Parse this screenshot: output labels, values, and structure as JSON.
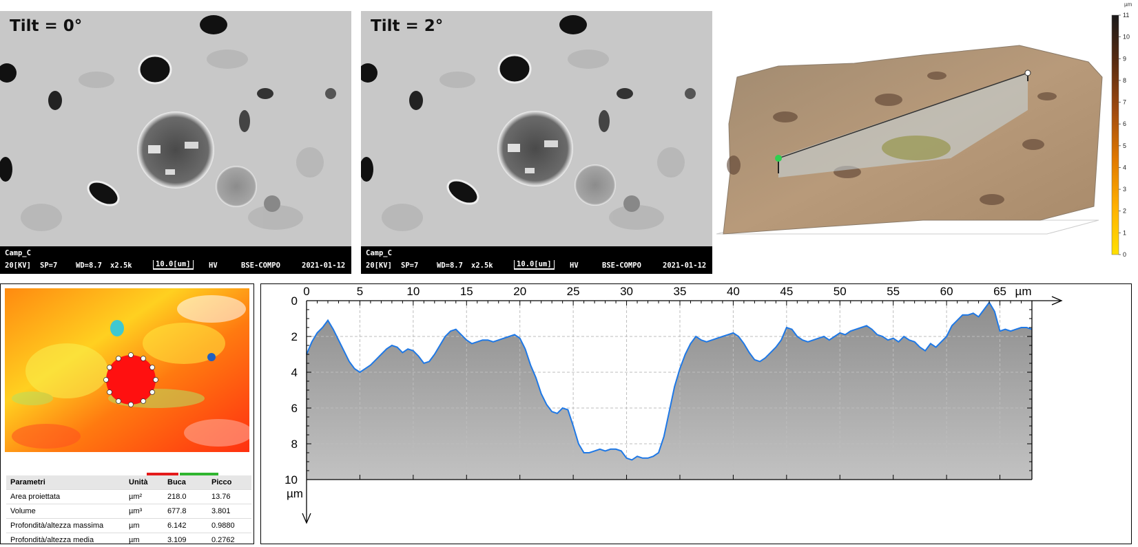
{
  "sem_panels": [
    {
      "tilt": "Tilt = 0°",
      "sample": "Camp_C",
      "kv": "20[KV]",
      "sp": "SP=7",
      "wd": "WD=8.7",
      "mag": "x2.5k",
      "scale": "10.0[um]",
      "hv": "HV",
      "mode": "BSE-COMPO",
      "date": "2021-01-12"
    },
    {
      "tilt": "Tilt = 2°",
      "sample": "Camp_C",
      "kv": "20[KV]",
      "sp": "SP=7",
      "wd": "WD=8.7",
      "mag": "x2.5k",
      "scale": "10.0[um]",
      "hv": "HV",
      "mode": "BSE-COMPO",
      "date": "2021-01-12"
    }
  ],
  "colorbar": {
    "unit": "µm",
    "ticks": [
      "0",
      "1",
      "2",
      "3",
      "4",
      "5",
      "6",
      "7",
      "8",
      "9",
      "10",
      "11"
    ],
    "colors": [
      "#ffe000",
      "#ffb000",
      "#e07800",
      "#a04a10",
      "#5a2c10",
      "#1a1a1a"
    ]
  },
  "params_table": {
    "headers": {
      "param": "Parametri",
      "unit": "Unità",
      "buca": "Buca",
      "picco": "Picco"
    },
    "legend_colors": {
      "buca": "#e41b1b",
      "picco": "#2fb52f"
    },
    "rows": [
      {
        "name": "Area proiettata",
        "unit": "µm²",
        "buca": "218.0",
        "picco": "13.76"
      },
      {
        "name": "Volume",
        "unit": "µm³",
        "buca": "677.8",
        "picco": "3.801"
      },
      {
        "name": "Profondità/altezza massima",
        "unit": "µm",
        "buca": "6.142",
        "picco": "0.9880"
      },
      {
        "name": "Profondità/altezza media",
        "unit": "µm",
        "buca": "3.109",
        "picco": "0.2762"
      }
    ]
  },
  "chart_data": {
    "type": "area",
    "title": "",
    "x_unit": "µm",
    "y_unit": "µm",
    "x_axis_position": "top",
    "y_inverted": true,
    "xlim": [
      0,
      68
    ],
    "ylim": [
      0,
      10
    ],
    "x_ticks": [
      0,
      5,
      10,
      15,
      20,
      25,
      30,
      35,
      40,
      45,
      50,
      55,
      60,
      65
    ],
    "y_ticks": [
      0,
      2,
      4,
      6,
      8,
      10
    ],
    "grid": true,
    "line_color": "#1e78e6",
    "fill_color": "#9a9a9a",
    "series": [
      {
        "x": [
          0,
          0.5,
          1,
          1.5,
          2,
          2.5,
          3,
          3.5,
          4,
          4.5,
          5,
          5.5,
          6,
          6.5,
          7,
          7.5,
          8,
          8.5,
          9,
          9.5,
          10,
          10.5,
          11,
          11.5,
          12,
          12.5,
          13,
          13.5,
          14,
          14.5,
          15,
          15.5,
          16,
          16.5,
          17,
          17.5,
          18,
          18.5,
          19,
          19.5,
          20,
          20.5,
          21,
          21.5,
          22,
          22.5,
          23,
          23.5,
          24,
          24.5,
          25,
          25.5,
          26,
          26.5,
          27,
          27.5,
          28,
          28.5,
          29,
          29.5,
          30,
          30.5,
          31,
          31.5,
          32,
          32.5,
          33,
          33.5,
          34,
          34.5,
          35,
          35.5,
          36,
          36.5,
          37,
          37.5,
          38,
          38.5,
          39,
          39.5,
          40,
          40.5,
          41,
          41.5,
          42,
          42.5,
          43,
          43.5,
          44,
          44.5,
          45,
          45.5,
          46,
          46.5,
          47,
          47.5,
          48,
          48.5,
          49,
          49.5,
          50,
          50.5,
          51,
          51.5,
          52,
          52.5,
          53,
          53.5,
          54,
          54.5,
          55,
          55.5,
          56,
          56.5,
          57,
          57.5,
          58,
          58.5,
          59,
          59.5,
          60,
          60.5,
          61,
          61.5,
          62,
          62.5,
          63,
          63.5,
          64,
          64.5,
          65,
          65.5,
          66,
          66.5,
          67,
          67.5,
          68
        ],
        "y": [
          3.0,
          2.3,
          1.8,
          1.5,
          1.1,
          1.6,
          2.2,
          2.8,
          3.4,
          3.8,
          4.0,
          3.8,
          3.6,
          3.3,
          3.0,
          2.7,
          2.5,
          2.6,
          2.9,
          2.7,
          2.8,
          3.1,
          3.5,
          3.4,
          3.0,
          2.5,
          2.0,
          1.7,
          1.6,
          1.9,
          2.2,
          2.4,
          2.3,
          2.2,
          2.2,
          2.3,
          2.2,
          2.1,
          2.0,
          1.9,
          2.1,
          2.7,
          3.6,
          4.3,
          5.2,
          5.8,
          6.2,
          6.3,
          6.0,
          6.1,
          7.0,
          8.0,
          8.5,
          8.5,
          8.4,
          8.3,
          8.4,
          8.3,
          8.3,
          8.4,
          8.8,
          8.9,
          8.7,
          8.8,
          8.8,
          8.7,
          8.5,
          7.6,
          6.2,
          4.8,
          3.8,
          3.0,
          2.4,
          2.0,
          2.2,
          2.3,
          2.2,
          2.1,
          2.0,
          1.9,
          1.8,
          2.0,
          2.4,
          2.9,
          3.3,
          3.4,
          3.2,
          2.9,
          2.6,
          2.2,
          1.5,
          1.6,
          2.0,
          2.2,
          2.3,
          2.2,
          2.1,
          2.0,
          2.2,
          2.0,
          1.8,
          1.9,
          1.7,
          1.6,
          1.5,
          1.4,
          1.6,
          1.9,
          2.0,
          2.2,
          2.1,
          2.3,
          2.0,
          2.2,
          2.3,
          2.6,
          2.8,
          2.4,
          2.6,
          2.3,
          2.0,
          1.4,
          1.1,
          0.8,
          0.8,
          0.7,
          0.9,
          0.5,
          0.1,
          0.6,
          1.7,
          1.6,
          1.7,
          1.6,
          1.5,
          1.5,
          1.6
        ]
      }
    ]
  }
}
